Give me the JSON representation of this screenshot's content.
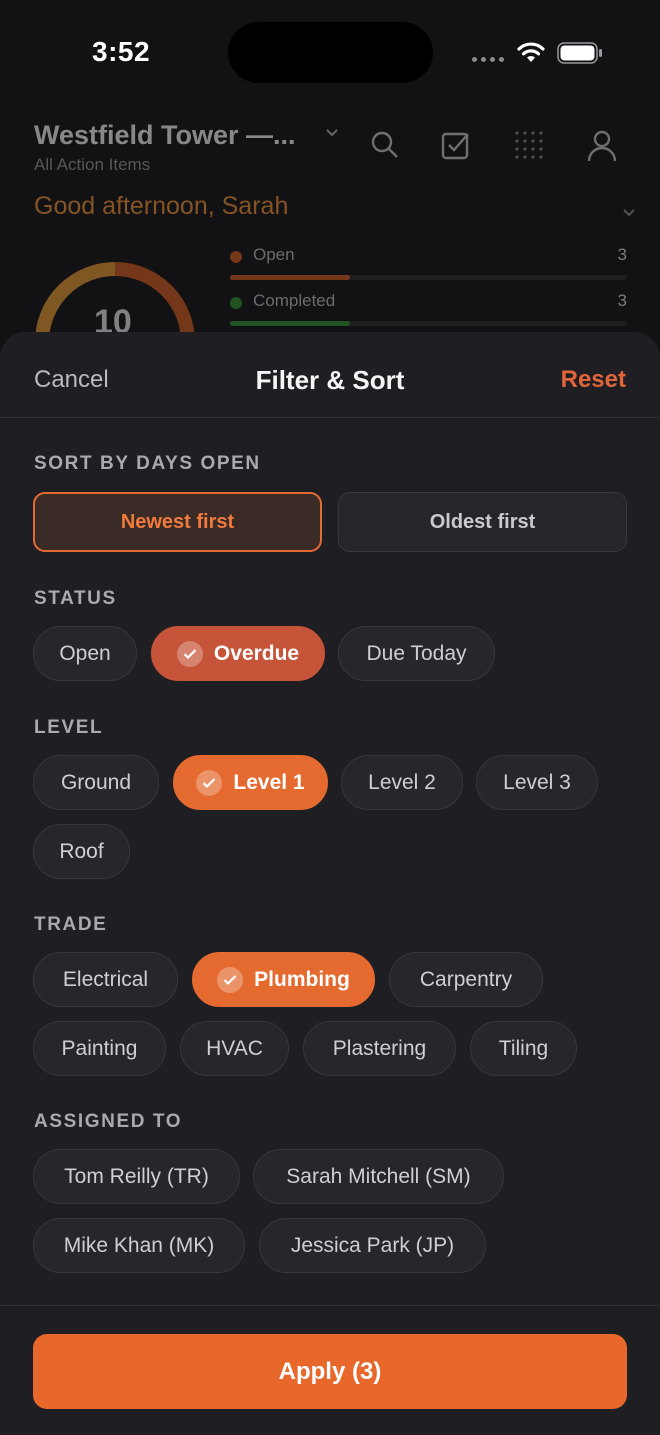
{
  "status_bar": {
    "time": "3:52"
  },
  "background": {
    "project_title": "Westfield Tower —...",
    "project_subtitle": "All Action Items",
    "greeting": "Good afternoon, Sarah",
    "donut_total": "10",
    "stats": [
      {
        "label": "Open",
        "value": "3",
        "color": "#c4561e"
      },
      {
        "label": "Completed",
        "value": "3",
        "color": "#2f8a2f"
      }
    ]
  },
  "sheet": {
    "cancel": "Cancel",
    "title": "Filter & Sort",
    "reset": "Reset",
    "sort": {
      "label": "SORT BY DAYS OPEN",
      "options": [
        "Newest first",
        "Oldest first"
      ],
      "selected": "Newest first"
    },
    "status": {
      "label": "STATUS",
      "chips": [
        "Open",
        "Overdue",
        "Due Today"
      ],
      "selected": "Overdue"
    },
    "level": {
      "label": "LEVEL",
      "chips": [
        "Ground",
        "Level 1",
        "Level 2",
        "Level 3",
        "Roof"
      ],
      "selected": "Level 1"
    },
    "trade": {
      "label": "TRADE",
      "chips": [
        "Electrical",
        "Plumbing",
        "Carpentry",
        "Painting",
        "HVAC",
        "Plastering",
        "Tiling"
      ],
      "selected": "Plumbing"
    },
    "assigned": {
      "label": "ASSIGNED TO",
      "chips": [
        "Tom Reilly (TR)",
        "Sarah Mitchell (SM)",
        "Mike Khan (MK)",
        "Jessica Park (JP)"
      ]
    },
    "apply": "Apply (3)"
  },
  "colors": {
    "accent": "#e8682b",
    "danger": "#c65438",
    "reset": "#e0653a"
  }
}
